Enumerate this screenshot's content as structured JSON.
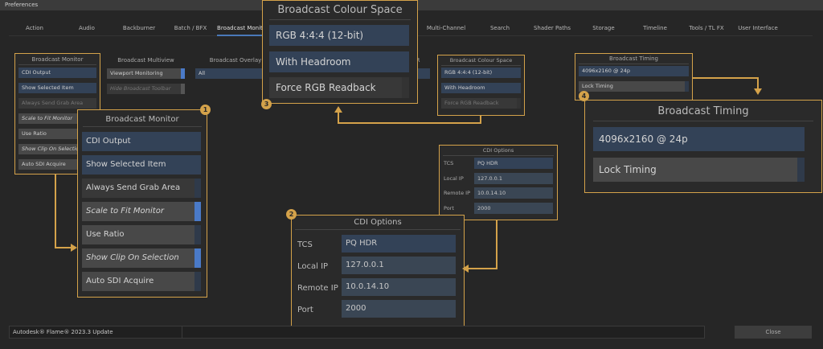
{
  "window": {
    "title": "Preferences"
  },
  "tabs": [
    "Action",
    "Audio",
    "Backburner",
    "Batch / BFX",
    "Broadcast Monitor",
    "Multi-Channel",
    "Search",
    "Shader Paths",
    "Storage",
    "Timeline",
    "Tools / TL FX",
    "User Interface"
  ],
  "active_tab": "Broadcast Monitor",
  "broadcast_monitor": {
    "title": "Broadcast Monitor",
    "items": [
      "CDI Output",
      "Show Selected Item",
      "Always Send Grab Area",
      "Scale to Fit Monitor",
      "Use Ratio",
      "Show Clip On Selection",
      "Auto SDI Acquire"
    ]
  },
  "broadcast_multiview": {
    "title": "Broadcast Multiview",
    "items": [
      "Viewport Monitoring",
      "Hide Broadcast Toolbar"
    ]
  },
  "broadcast_overlay": {
    "title": "Broadcast Overlay",
    "value": "All"
  },
  "partial_label": "R",
  "colour_space": {
    "title": "Broadcast Colour Space",
    "items": [
      "RGB 4:4:4 (12-bit)",
      "With Headroom",
      "Force RGB Readback"
    ]
  },
  "timing": {
    "title": "Broadcast Timing",
    "items": [
      "4096x2160 @ 24p",
      "Lock Timing"
    ]
  },
  "cdi": {
    "title": "CDI Options",
    "rows": [
      {
        "label": "TCS",
        "value": "PQ HDR"
      },
      {
        "label": "Local IP",
        "value": "127.0.0.1"
      },
      {
        "label": "Remote IP",
        "value": "10.0.14.10"
      },
      {
        "label": "Port",
        "value": "2000"
      }
    ]
  },
  "callouts": [
    "1",
    "2",
    "3",
    "4"
  ],
  "status": {
    "text": "Autodesk® Flame®  2023.3 Update"
  },
  "close_label": "Close",
  "colors": {
    "accent": "#d4a24a",
    "toggle_on": "#4a7ac8",
    "field_blue": "#334257"
  }
}
